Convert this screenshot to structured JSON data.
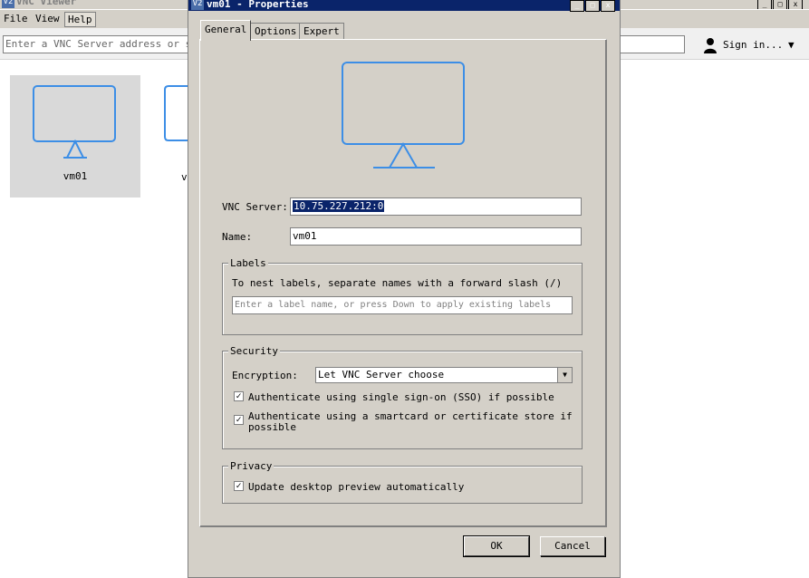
{
  "main": {
    "title": "VNC Viewer",
    "logo_text": "V2",
    "menu": [
      "File",
      "View",
      "Help"
    ],
    "address_placeholder": "Enter a VNC Server address or sea",
    "sign_in": "Sign in...",
    "tiles": [
      {
        "label": "vm01"
      },
      {
        "label": "v"
      }
    ]
  },
  "dialog": {
    "title": "vm01 - Properties",
    "logo_text": "V2",
    "tabs": [
      "General",
      "Options",
      "Expert"
    ],
    "vnc_server_label": "VNC Server:",
    "vnc_server_value": "10.75.227.212:0",
    "name_label": "Name:",
    "name_value": "vm01",
    "labels": {
      "title": "Labels",
      "hint": "To nest labels, separate names with a forward slash (/)",
      "placeholder": "Enter a label name, or press Down to apply existing labels"
    },
    "security": {
      "title": "Security",
      "encryption_label": "Encryption:",
      "encryption_value": "Let VNC Server choose",
      "sso_label": "Authenticate using single sign-on (SSO) if possible",
      "sso_checked": true,
      "smartcard_label_1": "Authenticate using a smartcard or certificate store if",
      "smartcard_label_2": "possible",
      "smartcard_checked": true
    },
    "privacy": {
      "title": "Privacy",
      "preview_label": "Update desktop preview automatically",
      "preview_checked": true
    },
    "ok": "OK",
    "cancel": "Cancel"
  },
  "colors": {
    "monitor_icon": "#3c8ee6",
    "title_bar": "#0a246a",
    "face": "#d4d0c8"
  }
}
